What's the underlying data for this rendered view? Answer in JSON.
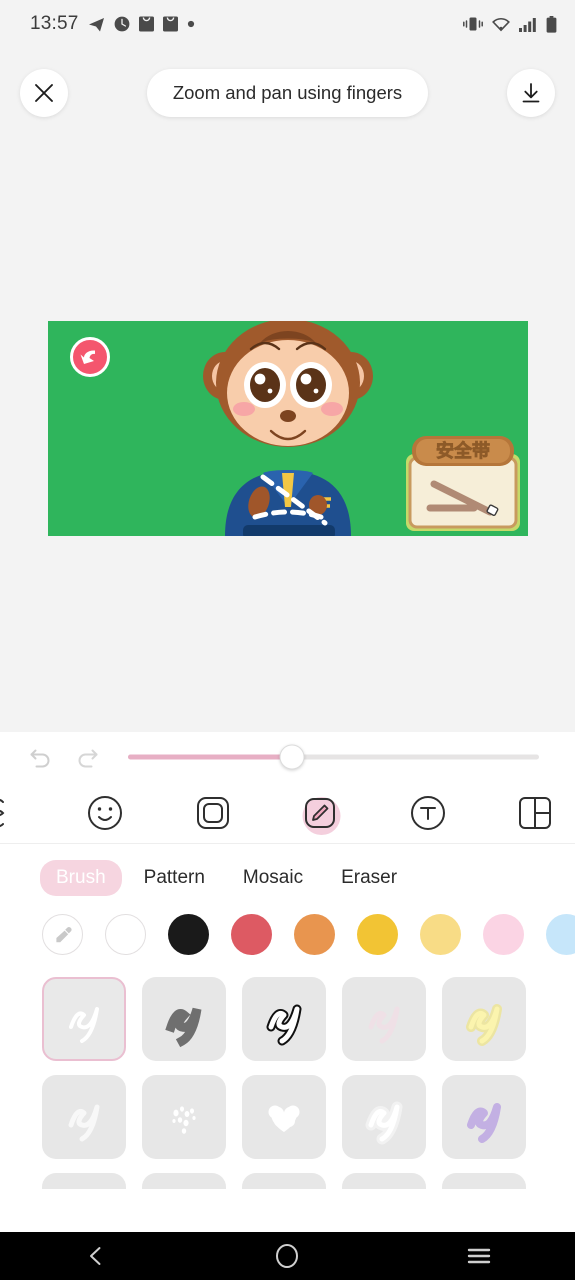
{
  "status_bar": {
    "time": "13:57",
    "left_icons": [
      "telegram-icon",
      "clock-icon",
      "mail-icon",
      "mail-icon",
      "dot-icon"
    ],
    "right_icons": [
      "vibrate-icon",
      "wifi-icon",
      "signal-icon",
      "battery-icon"
    ]
  },
  "header": {
    "close_label": "close-icon",
    "hint_text": "Zoom and pan using fingers",
    "download_label": "download-icon"
  },
  "artwork": {
    "background_color": "#2fb55c",
    "card_title": "安全带",
    "back_button": "back-arrow-icon"
  },
  "editor": {
    "undo_label": "undo-icon",
    "redo_label": "redo-icon",
    "slider": {
      "value_percent": 40,
      "fill_color": "#e7afc4",
      "track_color": "#e6e4e4"
    },
    "tools": [
      {
        "name": "crop-icon",
        "active": false
      },
      {
        "name": "sticker-icon",
        "active": false
      },
      {
        "name": "frame-icon",
        "active": false
      },
      {
        "name": "draw-icon",
        "active": true
      },
      {
        "name": "text-icon",
        "active": false
      },
      {
        "name": "layout-icon",
        "active": false
      }
    ],
    "tabs": [
      {
        "label": "Brush",
        "active": true
      },
      {
        "label": "Pattern",
        "active": false
      },
      {
        "label": "Mosaic",
        "active": false
      },
      {
        "label": "Eraser",
        "active": false
      }
    ],
    "active_tab_color": "#f6d5e0",
    "colors": [
      {
        "name": "eyedropper",
        "hex": "#ffffff"
      },
      {
        "name": "white",
        "hex": "#ffffff"
      },
      {
        "name": "black",
        "hex": "#1a1a1a"
      },
      {
        "name": "red",
        "hex": "#dd5a63"
      },
      {
        "name": "orange",
        "hex": "#e8954f"
      },
      {
        "name": "yellow",
        "hex": "#f2c434"
      },
      {
        "name": "light-yellow",
        "hex": "#f8dc86"
      },
      {
        "name": "pink",
        "hex": "#fbd4e4"
      },
      {
        "name": "light-blue",
        "hex": "#c6e6fa"
      },
      {
        "name": "periwinkle",
        "hex": "#bac3f4"
      },
      {
        "name": "violet",
        "hex": "#d3b6ee"
      }
    ],
    "brushes": [
      {
        "name": "pen-white",
        "selected": true
      },
      {
        "name": "marker-gray",
        "selected": false
      },
      {
        "name": "outline-black",
        "selected": false
      },
      {
        "name": "faint-pink",
        "selected": false
      },
      {
        "name": "neon-yellow",
        "selected": false
      },
      {
        "name": "soft-white",
        "selected": false
      },
      {
        "name": "sparkle",
        "selected": false
      },
      {
        "name": "cloud-heart",
        "selected": false
      },
      {
        "name": "glow-white",
        "selected": false
      },
      {
        "name": "purple-stroke",
        "selected": false
      }
    ]
  },
  "navbar": {
    "back_label": "nav-back-icon",
    "home_label": "nav-home-icon",
    "recents_label": "nav-recents-icon"
  }
}
